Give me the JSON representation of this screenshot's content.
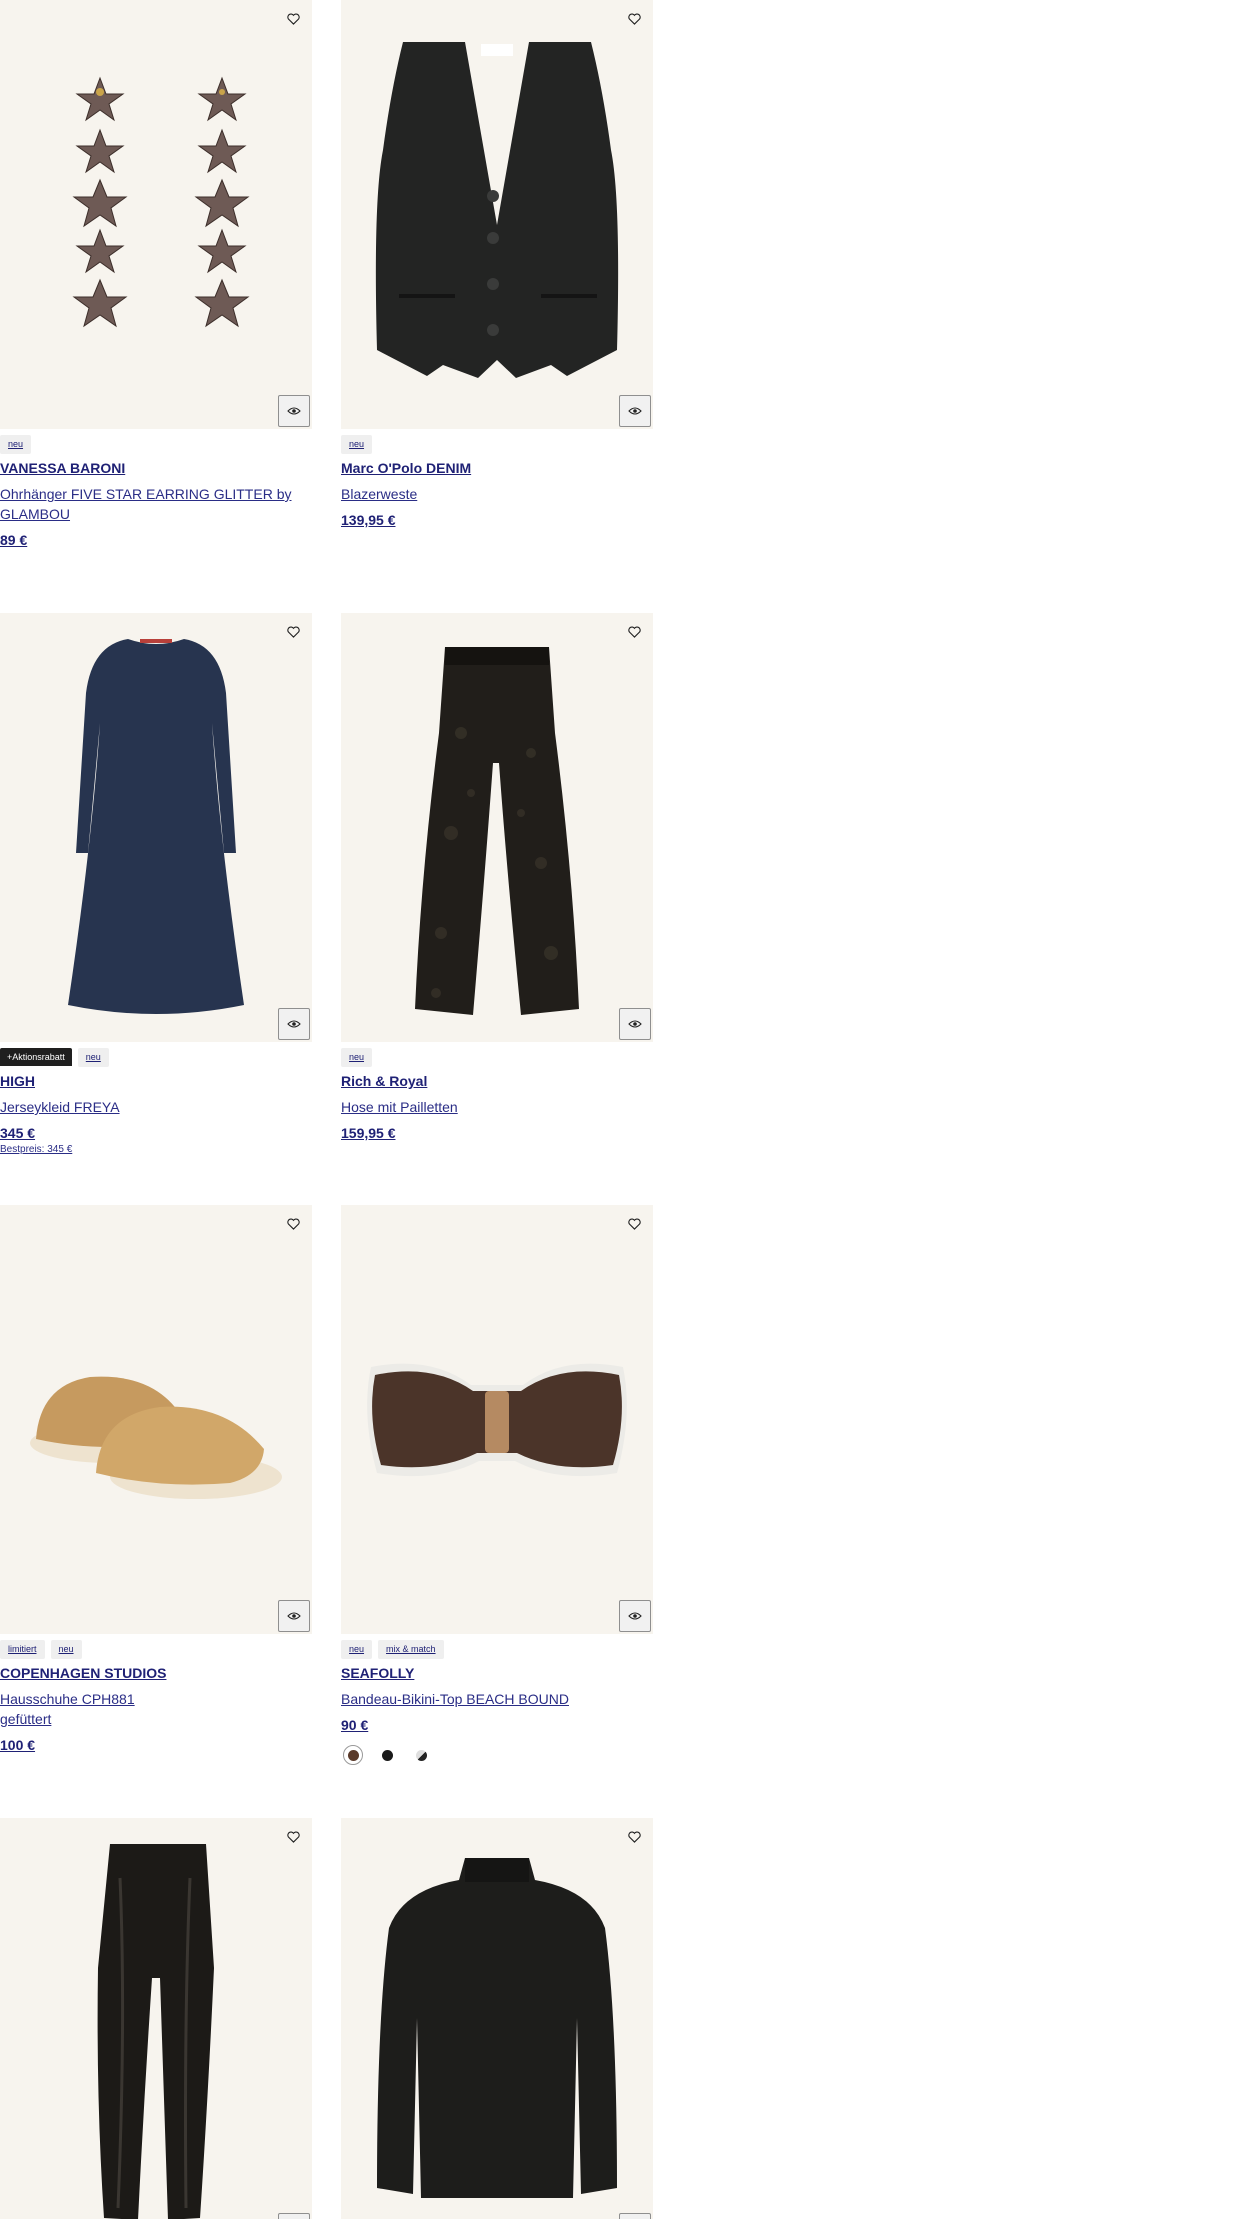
{
  "products": [
    {
      "brand": "VANESSA BARONI",
      "name": "Ohrhänger FIVE STAR EARRING GLITTER by GLAMBOU",
      "price": "89 €",
      "badges": [
        "neu"
      ]
    },
    {
      "brand": "Marc O'Polo DENIM",
      "name": "Blazerweste",
      "price": "139,95 €",
      "badges": [
        "neu"
      ]
    },
    {
      "brand": "HIGH",
      "name": "Jerseykleid FREYA",
      "price": "345 €",
      "best_price": "Bestpreis: 345 €",
      "badges": [
        "+Aktionsrabatt",
        "neu"
      ]
    },
    {
      "brand": "Rich & Royal",
      "name": "Hose mit Pailletten",
      "price": "159,95 €",
      "badges": [
        "neu"
      ]
    },
    {
      "brand": "COPENHAGEN STUDIOS",
      "name": "Hausschuhe CPH881",
      "name2": "gefüttert",
      "price": "100 €",
      "badges": [
        "limitiert",
        "neu"
      ]
    },
    {
      "brand": "SEAFOLLY",
      "name": "Bandeau-Bikini-Top BEACH BOUND",
      "price": "90 €",
      "badges": [
        "neu",
        "mix & match"
      ],
      "swatches": [
        {
          "color": "#5a3a2a",
          "selected": true
        },
        {
          "color": "#1a1a1a",
          "selected": false
        },
        {
          "color": "#222222",
          "selected": false,
          "split": true
        }
      ]
    },
    {
      "images_only": true
    },
    {
      "images_only": true
    }
  ],
  "icons": {
    "favorite": "heart-outline-icon",
    "quick_view": "eye-icon"
  },
  "colors": {
    "link": "#1f2175",
    "image_bg": "#f7f4ee"
  }
}
